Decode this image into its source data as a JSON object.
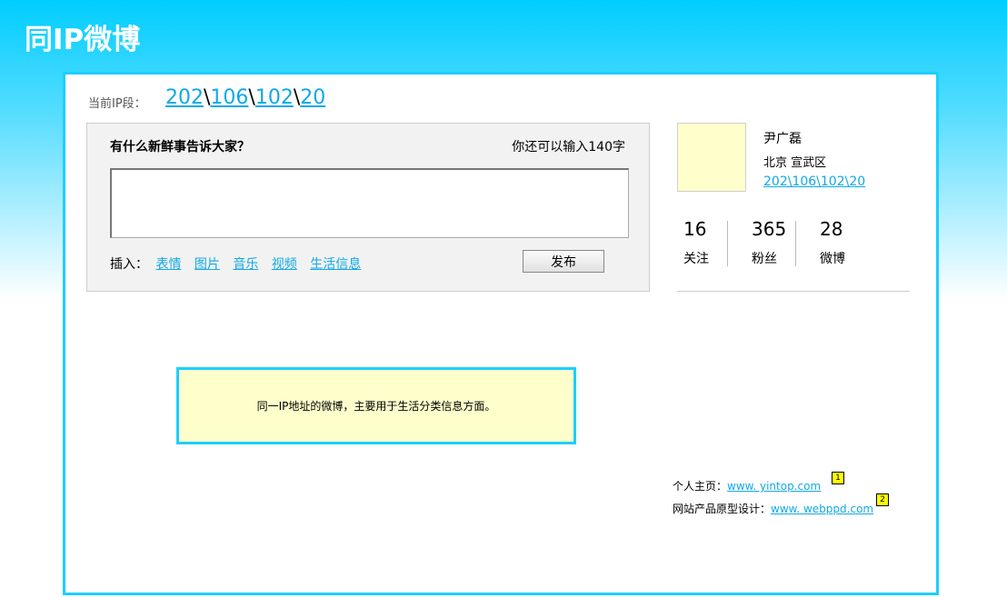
{
  "app": {
    "title": "同IP微博"
  },
  "ip_bar": {
    "label": "当前IP段：",
    "segments": [
      "202",
      "106",
      "102",
      "20"
    ],
    "separator": "\\"
  },
  "composer": {
    "prompt": "有什么新鲜事告诉大家？",
    "char_count": "你还可以输入140字",
    "text_value": "",
    "insert_label": "插入：",
    "insert_links": [
      "表情",
      "图片",
      "音乐",
      "视频",
      "生活信息"
    ],
    "publish_label": "发布"
  },
  "profile": {
    "name": "尹广磊",
    "location": "北京 宣武区",
    "ip": "202\\106\\102\\20"
  },
  "stats": [
    {
      "value": "16",
      "label": "关注"
    },
    {
      "value": "365",
      "label": "粉丝"
    },
    {
      "value": "28",
      "label": "微博"
    }
  ],
  "note": {
    "text": "同一IP地址的微博，主要用于生活分类信息方面。"
  },
  "footer": {
    "homepage_label": "个人主页：",
    "homepage_link": "www. yintop.com",
    "homepage_marker": "1",
    "design_label": "网站产品原型设计：",
    "design_link": "www. webppd.com",
    "design_marker": "2"
  },
  "colors": {
    "accent": "#1ccfff",
    "link": "#11a9e6",
    "note_bg": "#ffffcc",
    "marker": "#ffff00"
  }
}
